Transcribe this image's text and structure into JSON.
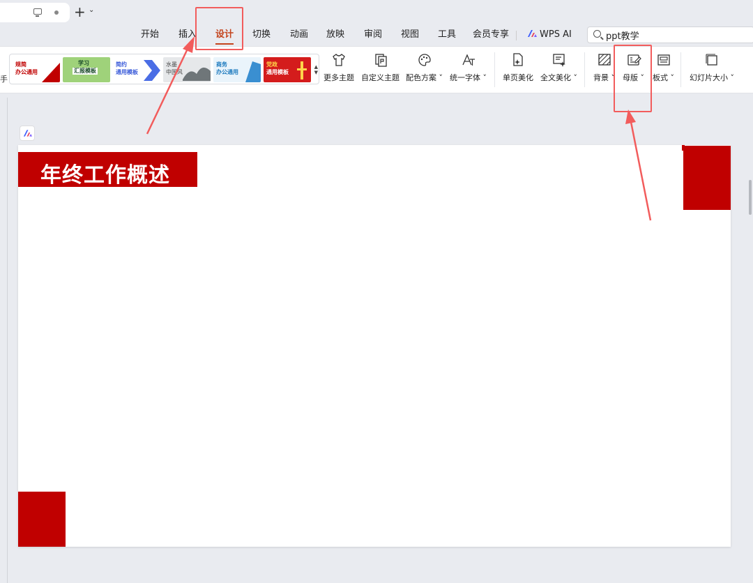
{
  "menu": {
    "items": [
      "开始",
      "插入",
      "设计",
      "切换",
      "动画",
      "放映",
      "审阅",
      "视图",
      "工具",
      "会员专享"
    ],
    "active_index": 2,
    "wps_ai_label": "WPS AI",
    "accent_color": "#c4441d"
  },
  "search": {
    "value": "ppt教学"
  },
  "ribbon": {
    "stub_label": "手",
    "templates": [
      {
        "line1": "规简",
        "line2": "办公通用"
      },
      {
        "line1": "学习",
        "line2": "汇报模板"
      },
      {
        "line1": "简约",
        "line2": "通用模板"
      },
      {
        "line1": "水墨",
        "line2": "中国风"
      },
      {
        "line1": "商务",
        "line2": "办公通用"
      },
      {
        "line1": "党政",
        "line2": "通用模板"
      }
    ],
    "more_themes": "更多主题",
    "custom_theme": "自定义主题",
    "color_scheme": "配色方案",
    "unify_font": "统一字体",
    "page_beautify": "单页美化",
    "full_beautify": "全文美化",
    "background": "背景",
    "master": "母版",
    "layout": "板式",
    "slide_size": "幻灯片大小"
  },
  "slide": {
    "title": "年终工作概述",
    "accent_color": "#c00000"
  },
  "annotation_color": "#f25c5c"
}
